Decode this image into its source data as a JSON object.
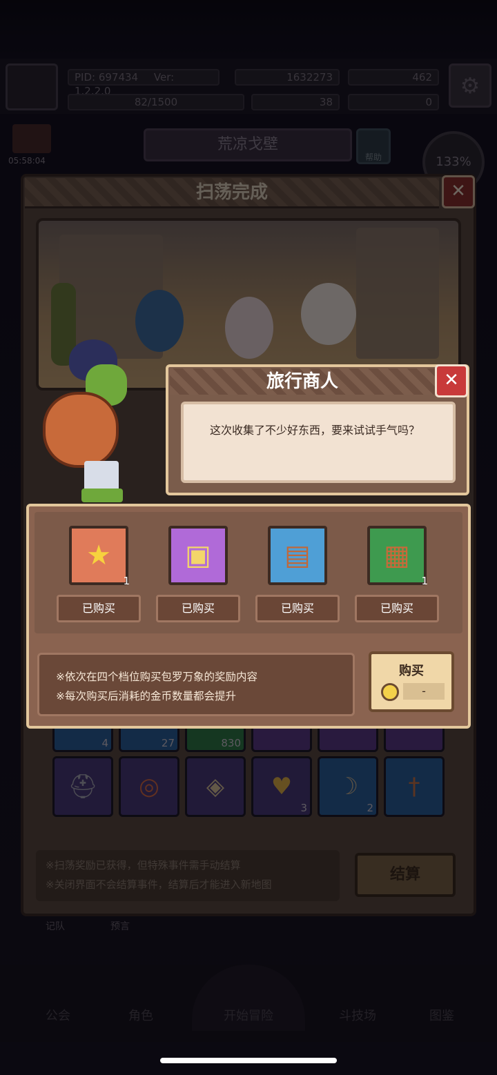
{
  "top": {
    "pid": "PID: 697434",
    "version": "Ver: 1.2.2.0",
    "gold": "1632273",
    "gems": "462",
    "stamina": "82/1500",
    "clover": "38",
    "keys": "0",
    "map_name": "荒凉戈壁",
    "help": "帮助",
    "timer": "05:58:04",
    "speed": "133%"
  },
  "sweep_panel": {
    "title": "扫荡完成",
    "footnote_1": "※扫荡奖励已获得，但特殊事件需手动结算",
    "footnote_2": "※关闭界面不会结算事件，结算后才能进入新地图",
    "settle_label": "结算",
    "tab_team": "记队",
    "tab_preview": "预言",
    "loot": [
      {
        "icon": "boot-icon",
        "count": "4"
      },
      {
        "icon": "ring-icon",
        "count": "27"
      },
      {
        "icon": "bag-icon",
        "count": "830"
      },
      {
        "icon": "helmet-icon",
        "count": ""
      },
      {
        "icon": "crown-icon",
        "count": ""
      },
      {
        "icon": "shield-icon",
        "count": ""
      },
      {
        "icon": "helmet-icon",
        "count": ""
      },
      {
        "icon": "belt-icon",
        "count": ""
      },
      {
        "icon": "scroll-icon",
        "count": ""
      },
      {
        "icon": "necklace-icon",
        "count": "3"
      },
      {
        "icon": "bow-icon",
        "count": "2"
      },
      {
        "icon": "dagger-icon",
        "count": ""
      }
    ]
  },
  "merchant_dialog": {
    "title": "旅行商人",
    "message": "这次收集了不少好东西，要来试试手气吗？"
  },
  "shop": {
    "items": [
      {
        "icon": "star-icon",
        "count": "1",
        "status": "已购买",
        "bg": "#e07b5a"
      },
      {
        "icon": "gold-card-icon",
        "count": "",
        "status": "已购买",
        "bg": "#b06ad8"
      },
      {
        "icon": "rune-card-icon",
        "count": "",
        "status": "已购买",
        "bg": "#4f9fd6"
      },
      {
        "icon": "chest-icon",
        "count": "1",
        "status": "已购买",
        "bg": "#3e9a4f"
      }
    ],
    "info_1": "※依次在四个档位购买包罗万象的奖励内容",
    "info_2": "※每次购买后消耗的金币数量都会提升",
    "buy_label": "购买",
    "buy_cost": "-"
  },
  "nav": {
    "guild": "公会",
    "character": "角色",
    "adventure": "开始冒险",
    "arena": "斗技场",
    "codex": "图鉴"
  }
}
